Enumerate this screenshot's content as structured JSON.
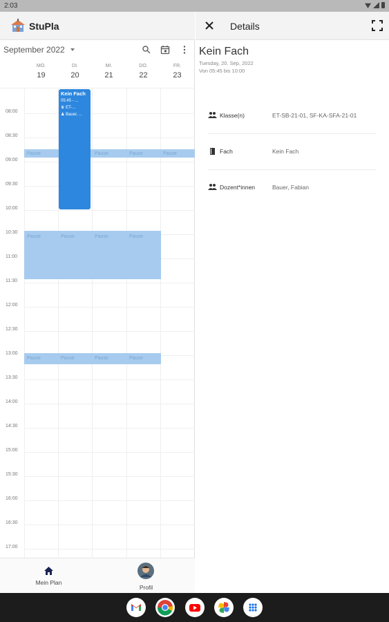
{
  "status_bar": {
    "time": "2:03"
  },
  "app": {
    "title": "StuPla"
  },
  "calendar": {
    "month_label": "September 2022",
    "days": [
      {
        "abbr": "MO.",
        "num": "19"
      },
      {
        "abbr": "DI.",
        "num": "20"
      },
      {
        "abbr": "MI.",
        "num": "21"
      },
      {
        "abbr": "DO.",
        "num": "22"
      },
      {
        "abbr": "FR.",
        "num": "23"
      }
    ],
    "times": [
      "08:00",
      "08:30",
      "09:00",
      "09:30",
      "10:00",
      "10:30",
      "11:00",
      "11:30",
      "12:00",
      "12:30",
      "13:00",
      "13:30",
      "14:00",
      "14:30",
      "15:00",
      "15:30",
      "16:00",
      "16:30",
      "17:00"
    ],
    "pause_label": "Pause",
    "event": {
      "title": "Kein Fach",
      "time": "05:45 - ...",
      "class": "ET-...",
      "lecturer": "Bauer, ..."
    }
  },
  "bottom_nav": {
    "items": [
      {
        "label": "Mein Plan"
      },
      {
        "label": "Profil"
      }
    ]
  },
  "details": {
    "header": "Details",
    "subject": "Kein Fach",
    "date": "Tuesday, 20. Sep, 2022",
    "time": "Von 05:45 bis 10:00",
    "rows": [
      {
        "label": "Klasse(n)",
        "value": "ET-SB-21-01, SF-KA-SFA-21-01",
        "icon": "group-icon"
      },
      {
        "label": "Fach",
        "value": "Kein Fach",
        "icon": "book-icon"
      },
      {
        "label": "Dozent*innen",
        "value": "Bauer, Fabian",
        "icon": "group-icon"
      }
    ]
  },
  "colors": {
    "event": "#2d87de",
    "pause": "#a6cbee"
  },
  "dock": [
    "gmail-icon",
    "chrome-icon",
    "youtube-icon",
    "photos-icon",
    "app-drawer-icon"
  ]
}
